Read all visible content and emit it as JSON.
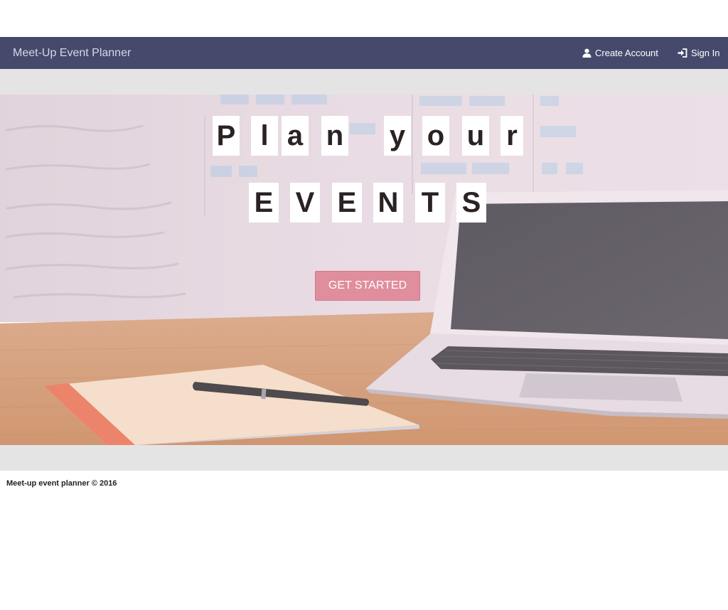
{
  "navbar": {
    "brand": "Meet-Up Event Planner",
    "create_account": "Create Account",
    "sign_in": "Sign In",
    "background_color": "#454a6d"
  },
  "hero": {
    "headline_line1": [
      "P",
      "l",
      "a",
      "n",
      "y",
      "o",
      "u",
      "r"
    ],
    "headline_line2": [
      "E",
      "V",
      "E",
      "N",
      "T",
      "S"
    ],
    "cta_label": "GET STARTED",
    "cta_color": "#e08d9d",
    "background_image": "desk-with-laptop-notebook-pen"
  },
  "footer": {
    "text": "Meet-up event planner © 2016"
  },
  "icons": {
    "create_account": "user-icon",
    "sign_in": "sign-in-icon"
  }
}
